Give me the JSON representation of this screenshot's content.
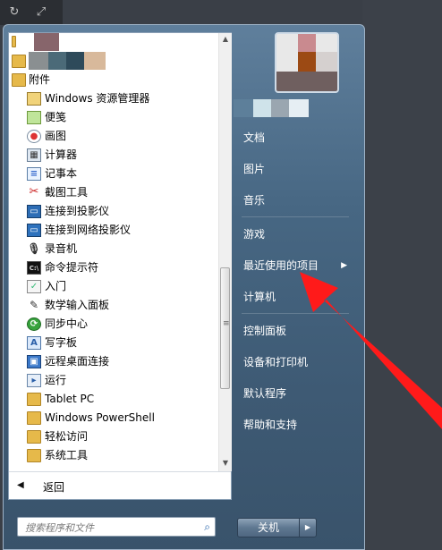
{
  "left_menu": {
    "items": [
      {
        "kind": "blur",
        "icon": "folder-icon"
      },
      {
        "kind": "blur",
        "icon": "folder-icon"
      },
      {
        "kind": "top",
        "label": "附件",
        "icon": "folder-icon"
      },
      {
        "kind": "sub",
        "label": "Windows 资源管理器",
        "icon": "explorer-icon"
      },
      {
        "kind": "sub",
        "label": "便笺",
        "icon": "sticky-notes-icon"
      },
      {
        "kind": "sub",
        "label": "画图",
        "icon": "paint-icon"
      },
      {
        "kind": "sub",
        "label": "计算器",
        "icon": "calculator-icon"
      },
      {
        "kind": "sub",
        "label": "记事本",
        "icon": "notepad-icon"
      },
      {
        "kind": "sub",
        "label": "截图工具",
        "icon": "snipping-tool-icon"
      },
      {
        "kind": "sub",
        "label": "连接到投影仪",
        "icon": "projector-icon"
      },
      {
        "kind": "sub",
        "label": "连接到网络投影仪",
        "icon": "network-projector-icon"
      },
      {
        "kind": "sub",
        "label": "录音机",
        "icon": "microphone-icon"
      },
      {
        "kind": "sub",
        "label": "命令提示符",
        "icon": "cmd-icon"
      },
      {
        "kind": "sub",
        "label": "入门",
        "icon": "getting-started-icon"
      },
      {
        "kind": "sub",
        "label": "数学输入面板",
        "icon": "math-input-icon"
      },
      {
        "kind": "sub",
        "label": "同步中心",
        "icon": "sync-center-icon"
      },
      {
        "kind": "sub",
        "label": "写字板",
        "icon": "wordpad-icon"
      },
      {
        "kind": "sub",
        "label": "远程桌面连接",
        "icon": "remote-desktop-icon"
      },
      {
        "kind": "sub",
        "label": "运行",
        "icon": "run-icon"
      },
      {
        "kind": "sub",
        "label": "Tablet PC",
        "icon": "folder-icon"
      },
      {
        "kind": "sub",
        "label": "Windows PowerShell",
        "icon": "folder-icon"
      },
      {
        "kind": "sub",
        "label": "轻松访问",
        "icon": "folder-icon"
      },
      {
        "kind": "sub",
        "label": "系统工具",
        "icon": "folder-icon"
      }
    ],
    "back_label": "返回",
    "search_placeholder": "搜索程序和文件"
  },
  "right_menu": {
    "items": [
      {
        "label": "文档"
      },
      {
        "label": "图片"
      },
      {
        "label": "音乐"
      },
      {
        "label": "游戏"
      },
      {
        "label": "最近使用的项目",
        "has_submenu": true
      },
      {
        "label": "计算机"
      },
      {
        "label": "控制面板"
      },
      {
        "label": "设备和打印机"
      },
      {
        "label": "默认程序"
      },
      {
        "label": "帮助和支持"
      }
    ],
    "shutdown_label": "关机"
  },
  "colors": {
    "menu_bg": "#476783",
    "annotation_arrow": "#ff1a1a",
    "folder": "#e6b94a"
  }
}
